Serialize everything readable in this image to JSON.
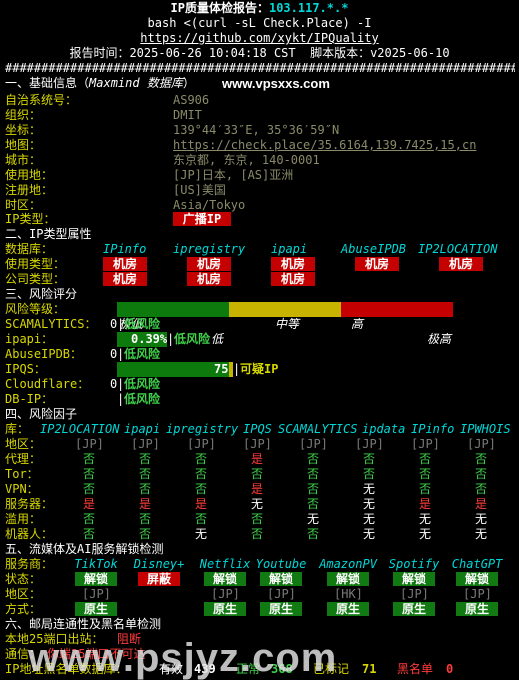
{
  "header": {
    "title": "IP质量体检报告：",
    "ip": "103.117.*.*",
    "command": "bash <(curl -sL Check.Place) -I",
    "url": "https://github.com/xykt/IPQuality",
    "report_time": "报告时间：2025-06-26 10:04:18 CST  脚本版本：v2025-06-10",
    "divider": "########################################################################"
  },
  "basic": {
    "title": "一、基础信息（",
    "db_name": "Maxmind 数据库",
    "title_end": "）",
    "watermark": "www.vpsxxs.com",
    "rows": [
      {
        "label": "自治系统号：",
        "value": "AS906"
      },
      {
        "label": "组织：",
        "value": "DMIT"
      },
      {
        "label": "坐标：",
        "value": "139°44′33″E, 35°36′59″N"
      },
      {
        "label": "地图：",
        "value": "https://check.place/35.6164,139.7425,15,cn"
      },
      {
        "label": "城市：",
        "value": "东京都, 东京, 140-0001"
      },
      {
        "label": "使用地：",
        "value": "[JP]日本, [AS]亚洲"
      },
      {
        "label": "注册地：",
        "value": "[US]美国"
      },
      {
        "label": "时区：",
        "value": "Asia/Tokyo"
      },
      {
        "label": "IP类型：",
        "value": "广播IP"
      }
    ]
  },
  "ip_type": {
    "title": "二、IP类型属性",
    "db_label": "数据库：",
    "dbs": [
      "IPinfo",
      "ipregistry",
      "ipapi",
      "AbuseIPDB",
      "IP2LOCATION"
    ],
    "usage_label": "使用类型：",
    "usage": [
      "机房",
      "机房",
      "机房",
      "机房",
      "机房"
    ],
    "company_label": "公司类型：",
    "company": [
      "机房",
      "机房",
      "机房"
    ]
  },
  "risk": {
    "title": "三、风险评分",
    "level_label": "风险等级：",
    "levels": [
      "极低",
      "低",
      "中等",
      "高",
      "极高"
    ],
    "rows": [
      {
        "label": "SCAMALYTICS：",
        "score": "0",
        "text": "低风险",
        "fill": 0
      },
      {
        "label": "ipapi：",
        "score": "0.39%",
        "text": "低风险",
        "fill": 0.0039
      },
      {
        "label": "AbuseIPDB：",
        "score": "0",
        "text": "低风险",
        "fill": 0
      },
      {
        "label": "IPQS：",
        "score": "75",
        "text": "可疑IP",
        "fill": 0.75
      },
      {
        "label": "Cloudflare：",
        "score": "0",
        "text": "低风险",
        "fill": 0
      },
      {
        "label": "DB-IP：",
        "score": "",
        "text": "低风险",
        "fill": 0
      }
    ]
  },
  "factors": {
    "title": "四、风险因子",
    "db_label": "库：",
    "dbs": [
      "IP2LOCATION",
      "ipapi",
      "ipregistry",
      "IPQS",
      "SCAMALYTICS",
      "ipdata",
      "IPinfo",
      "IPWHOIS"
    ],
    "rows": [
      {
        "label": "地区：",
        "values": [
          "[JP]",
          "[JP]",
          "[JP]",
          "[JP]",
          "[JP]",
          "[JP]",
          "[JP]",
          "[JP]"
        ]
      },
      {
        "label": "代理：",
        "values": [
          "否",
          "否",
          "否",
          "是",
          "否",
          "否",
          "否",
          "否"
        ]
      },
      {
        "label": "Tor：",
        "values": [
          "否",
          "否",
          "否",
          "否",
          "否",
          "否",
          "否",
          "否"
        ]
      },
      {
        "label": "VPN：",
        "values": [
          "否",
          "否",
          "否",
          "是",
          "否",
          "无",
          "否",
          "否"
        ]
      },
      {
        "label": "服务器：",
        "values": [
          "是",
          "是",
          "是",
          "无",
          "否",
          "无",
          "是",
          "是"
        ]
      },
      {
        "label": "滥用：",
        "values": [
          "否",
          "否",
          "否",
          "否",
          "无",
          "无",
          "无",
          "无"
        ]
      },
      {
        "label": "机器人：",
        "values": [
          "否",
          "否",
          "无",
          "否",
          "否",
          "无",
          "无",
          "无"
        ]
      }
    ]
  },
  "media": {
    "title": "五、流媒体及AI服务解锁检测",
    "service_label": "服务商：",
    "services": [
      "TikTok",
      "Disney+",
      "Netflix",
      "Youtube",
      "AmazonPV",
      "Spotify",
      "ChatGPT"
    ],
    "status_label": "状态：",
    "status": [
      "解锁",
      "屏蔽",
      "解锁",
      "解锁",
      "解锁",
      "解锁",
      "解锁"
    ],
    "region_label": "地区：",
    "regions": [
      "[JP]",
      "",
      "[JP]",
      "[JP]",
      "[HK]",
      "[JP]",
      "[JP]"
    ],
    "method_label": "方式：",
    "methods": [
      "原生",
      "",
      "原生",
      "原生",
      "原生",
      "原生",
      "原生"
    ]
  },
  "mail": {
    "title": "六、邮局连通性及黑名单检测",
    "port_label": "本地25端口出站：",
    "port_value": "阻断",
    "comm_label": "通信：",
    "comm_value": "你端25端口不可达",
    "bl_label": "IP地址黑名单数据库：",
    "bl_valid_label": "有效",
    "bl_valid": "439",
    "bl_normal_label": "正常",
    "bl_normal": "368",
    "bl_marked_label": "已标记",
    "bl_marked": "71",
    "bl_black_label": "黑名单",
    "bl_black": "0"
  },
  "overlay_watermark": "www.psjyz.com",
  "colors": {
    "cyan": "#00d7d7",
    "yellow": "#d7d700",
    "green": "#3fd24a",
    "red": "#ff3b3b"
  }
}
